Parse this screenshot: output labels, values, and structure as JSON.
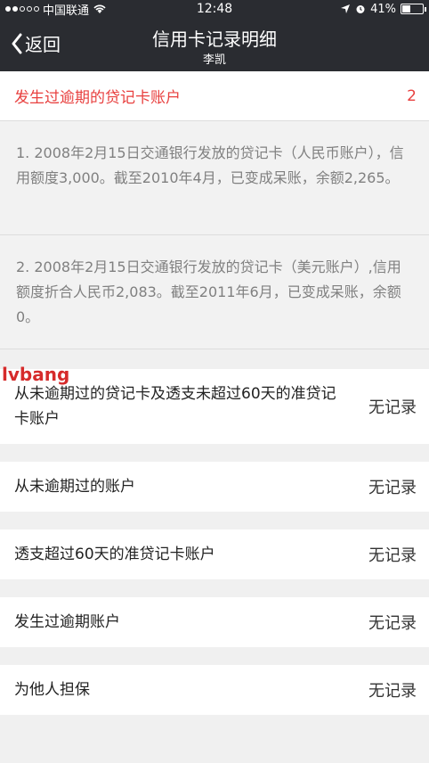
{
  "status_bar": {
    "carrier": "中国联通",
    "time": "12:48",
    "battery": "41%",
    "battery_level": 0.41
  },
  "nav": {
    "back_label": "返回",
    "title": "信用卡记录明细",
    "subtitle": "李凯"
  },
  "overdue_header": {
    "label": "发生过逾期的贷记卡账户",
    "count": "2"
  },
  "details": [
    {
      "text": "1. 2008年2月15日交通银行发放的贷记卡（人民币账户），信用额度3,000。截至2010年4月，已变成呆账，余额2,265。"
    },
    {
      "text": "2. 2008年2月15日交通银行发放的贷记卡（美元账户）,信用额度折合人民币2,083。截至2011年6月，已变成呆账，余额0。"
    }
  ],
  "items": [
    {
      "label": "从未逾期过的贷记卡及透支未超过60天的准贷记卡账户",
      "value": "无记录"
    },
    {
      "label": "从未逾期过的账户",
      "value": "无记录"
    },
    {
      "label": "透支超过60天的准贷记卡账户",
      "value": "无记录"
    },
    {
      "label": "发生过逾期账户",
      "value": "无记录"
    },
    {
      "label": "为他人担保",
      "value": "无记录"
    }
  ],
  "watermark": "lvbang"
}
